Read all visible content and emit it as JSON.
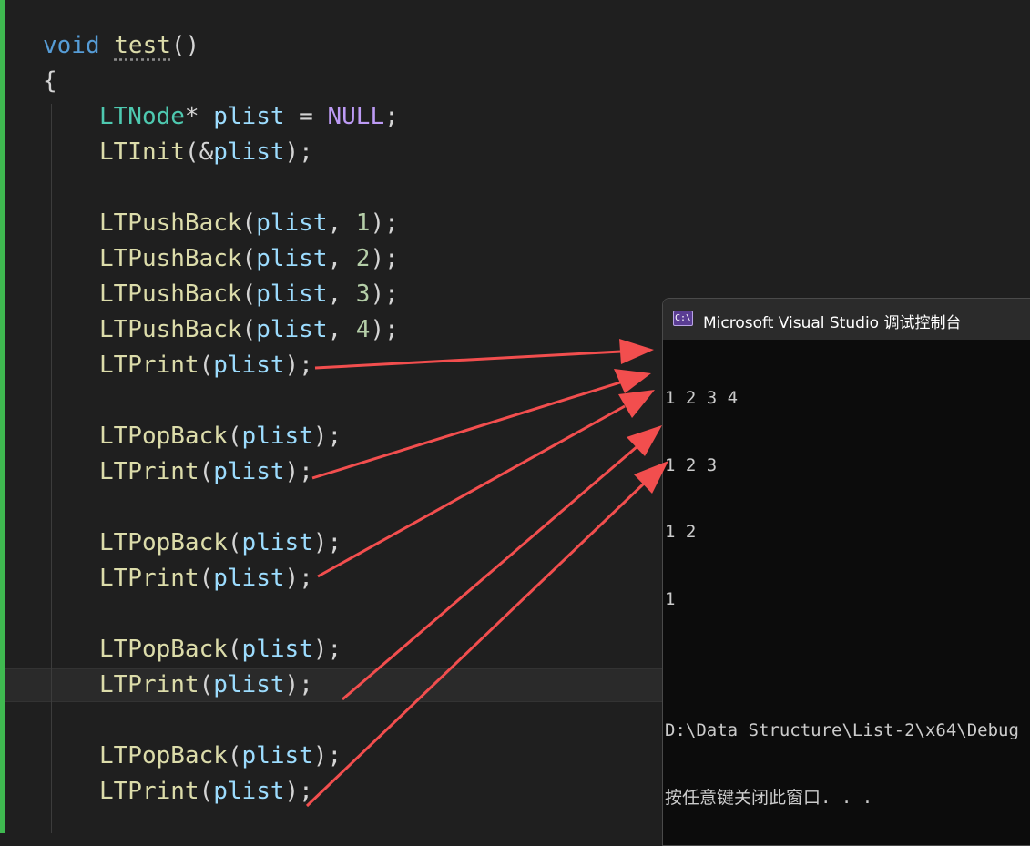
{
  "editor": {
    "signature": {
      "return_type": "void",
      "name": "test",
      "params": "()"
    },
    "open_brace": "{",
    "decl": {
      "type": "LTNode",
      "star": "*",
      "var": "plist",
      "eq": "=",
      "value": "NULL",
      "semi": ";"
    },
    "init": {
      "fn": "LTInit",
      "open": "(",
      "amp": "&",
      "arg": "plist",
      "close": ");"
    },
    "push_calls": [
      {
        "fn": "LTPushBack",
        "arg": "plist",
        "sep": ", ",
        "num": "1",
        "close": ");"
      },
      {
        "fn": "LTPushBack",
        "arg": "plist",
        "sep": ", ",
        "num": "2",
        "close": ");"
      },
      {
        "fn": "LTPushBack",
        "arg": "plist",
        "sep": ", ",
        "num": "3",
        "close": ");"
      },
      {
        "fn": "LTPushBack",
        "arg": "plist",
        "sep": ", ",
        "num": "4",
        "close": ");"
      }
    ],
    "print_fn": "LTPrint",
    "pop_fn": "LTPopBack",
    "call_arg": "plist",
    "open_paren": "(",
    "close_stmt": ");"
  },
  "console": {
    "title": "Microsoft Visual Studio 调试控制台",
    "icon_text": "C:\\",
    "output": [
      "1 2 3 4",
      "1 2 3",
      "1 2",
      "1"
    ],
    "path_line": "D:\\Data Structure\\List-2\\x64\\Debug",
    "prompt": "按任意键关闭此窗口. . ."
  },
  "annotation": {
    "arrow_color": "#f24e4e"
  },
  "colors": {
    "keyword": "#569cd6",
    "function": "#dcdcaa",
    "type": "#4ec9b0",
    "variable": "#9cdcfe",
    "number": "#b5cea8",
    "macro": "#bd9bf5",
    "background": "#1f1f1f",
    "change_bar": "#3fb950"
  }
}
